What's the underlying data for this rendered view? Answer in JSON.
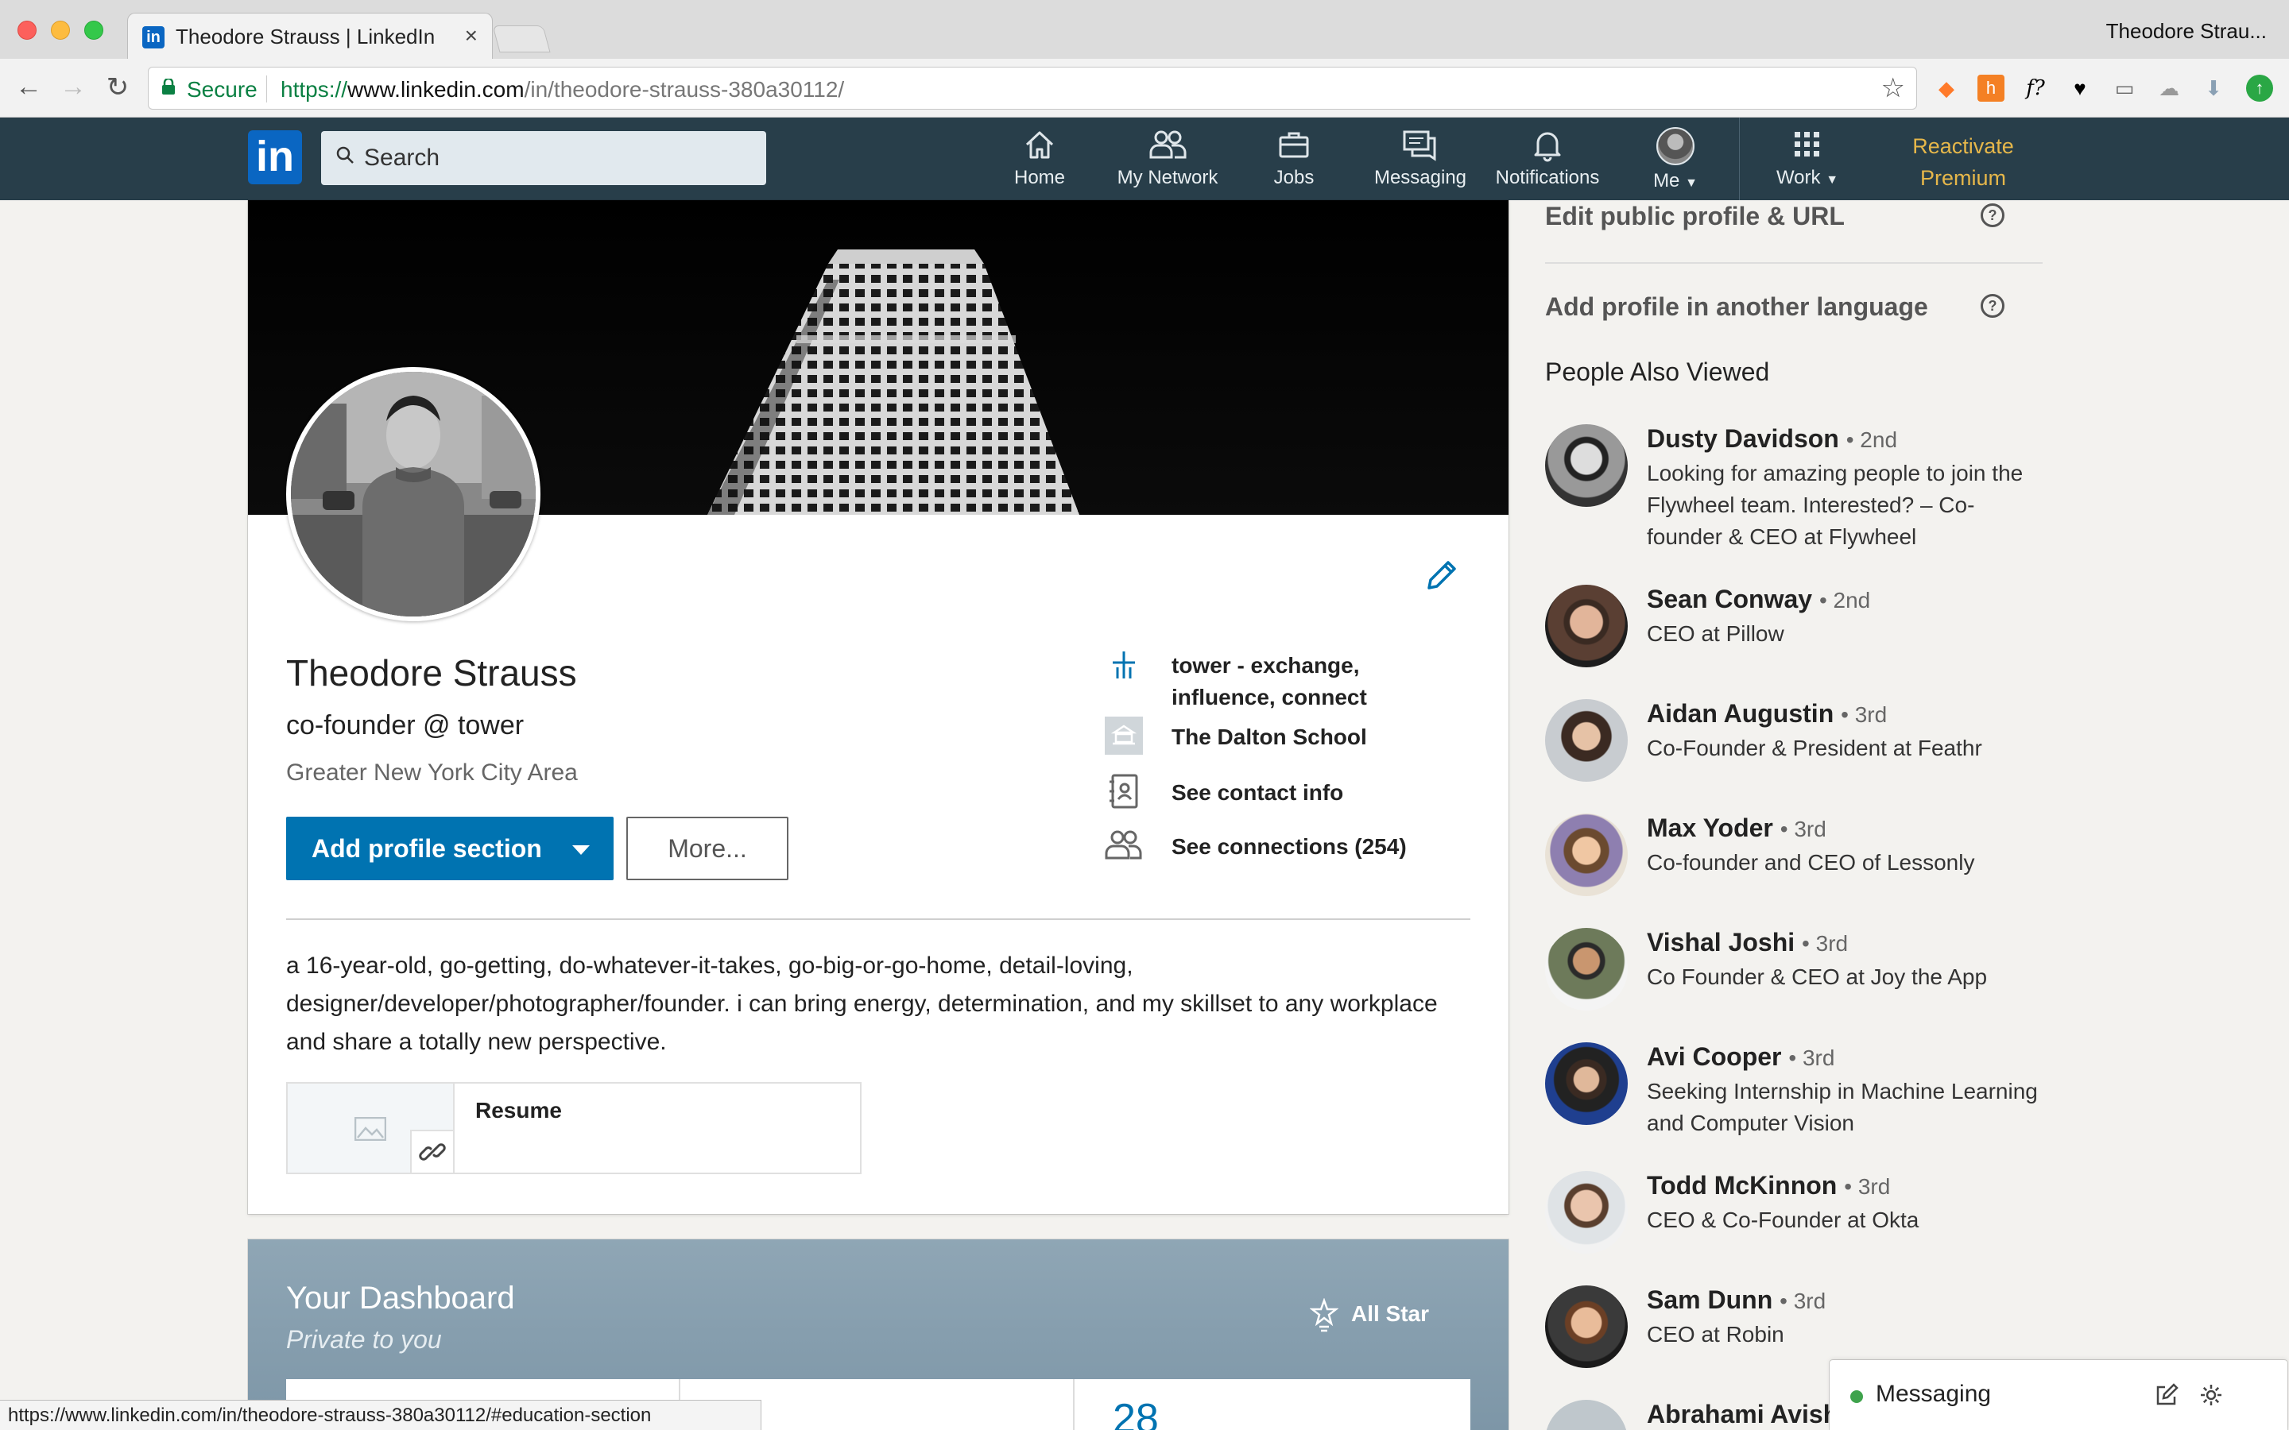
{
  "browser": {
    "tab_title": "Theodore Strauss | LinkedIn",
    "profile_name": "Theodore Strau...",
    "secure_label": "Secure",
    "url_scheme": "https://",
    "url_host": "www.linkedin.com",
    "url_path": "/in/theodore-strauss-380a30112/",
    "status_url": "https://www.linkedin.com/in/theodore-strauss-380a30112/#education-section"
  },
  "nav": {
    "logo": "in",
    "search_placeholder": "Search",
    "items": [
      {
        "label": "Home"
      },
      {
        "label": "My Network"
      },
      {
        "label": "Jobs"
      },
      {
        "label": "Messaging"
      },
      {
        "label": "Notifications"
      },
      {
        "label": "Me"
      },
      {
        "label": "Work"
      }
    ],
    "premium_line1": "Reactivate",
    "premium_line2": "Premium"
  },
  "profile": {
    "name": "Theodore Strauss",
    "headline": "co-founder @ tower",
    "location": "Greater New York City Area",
    "add_section_label": "Add profile section",
    "more_label": "More...",
    "info": [
      {
        "text_line1": "tower - exchange,",
        "text_line2": "influence, connect"
      },
      {
        "text_line1": "The Dalton School"
      },
      {
        "text_line1": "See contact info"
      },
      {
        "text_line1": "See connections (254)"
      }
    ],
    "summary": "a 16-year-old, go-getting, do-whatever-it-takes, go-big-or-go-home, detail-loving, designer/developer/photographer/founder. i can bring energy, determination, and my skillset to any workplace and share a totally new perspective.",
    "resume_title": "Resume"
  },
  "dashboard": {
    "title": "Your Dashboard",
    "subtitle": "Private to you",
    "badge": "All Star",
    "stat_partial": "28"
  },
  "rail": {
    "edit_public": "Edit public profile & URL",
    "add_language": "Add profile in another language",
    "people_title": "People Also Viewed",
    "people": [
      {
        "name": "Dusty Davidson",
        "degree": "• 2nd",
        "title": "Looking for amazing people to join the Flywheel team. Interested? – Co-founder & CEO at Flywheel"
      },
      {
        "name": "Sean Conway",
        "degree": "• 2nd",
        "title": "CEO at Pillow"
      },
      {
        "name": "Aidan Augustin",
        "degree": "• 3rd",
        "title": "Co-Founder & President at Feathr"
      },
      {
        "name": "Max Yoder",
        "degree": "• 3rd",
        "title": "Co-founder and CEO of Lessonly"
      },
      {
        "name": "Vishal Joshi",
        "degree": "• 3rd",
        "title": "Co Founder & CEO at Joy the App"
      },
      {
        "name": "Avi Cooper",
        "degree": "• 3rd",
        "title": "Seeking Internship in Machine Learning and Computer Vision"
      },
      {
        "name": "Todd McKinnon",
        "degree": "• 3rd",
        "title": "CEO & Co-Founder at Okta"
      },
      {
        "name": "Sam Dunn",
        "degree": "• 3rd",
        "title": "CEO at Robin"
      },
      {
        "name": "Abrahami Avish",
        "degree": "",
        "title": ""
      }
    ]
  },
  "messaging": {
    "label": "Messaging"
  },
  "colors": {
    "nav_bg": "#283e4a",
    "brand": "#0073b1",
    "premium": "#e6b74a",
    "secure": "#0b8043"
  },
  "icons": [
    "home-icon",
    "my-network-icon",
    "jobs-icon",
    "messaging-icon",
    "notifications-icon",
    "work-grid-icon",
    "pencil-icon",
    "tower-icon",
    "school-icon",
    "contact-card-icon",
    "connections-icon",
    "image-icon",
    "link-icon",
    "star-badge-icon",
    "help-icon",
    "compose-icon",
    "gear-icon"
  ]
}
